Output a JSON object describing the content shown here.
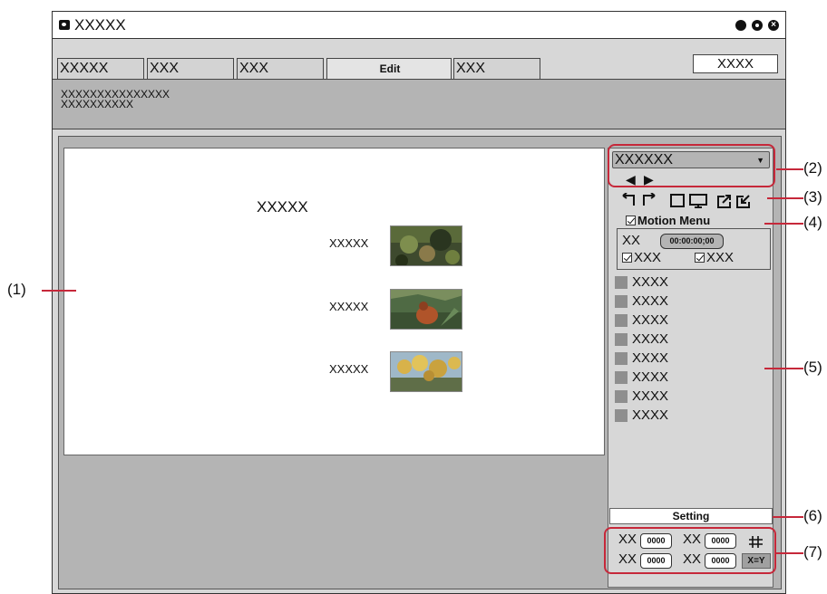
{
  "window": {
    "title": "XXXXX"
  },
  "tabs": [
    {
      "label": "XXXXX"
    },
    {
      "label": "XXX"
    },
    {
      "label": "XXX"
    },
    {
      "label": "Edit"
    },
    {
      "label": "XXX"
    }
  ],
  "top_right_button": "XXXX",
  "info": {
    "line1": "XXXXXXXXXXXXXXX",
    "line2": "XXXXXXXXXX"
  },
  "canvas": {
    "menu_title": "XXXXX",
    "items": [
      {
        "label": "XXXXX"
      },
      {
        "label": "XXXXX"
      },
      {
        "label": "XXXXX"
      }
    ]
  },
  "right_panel": {
    "preset_value": "XXXXXX",
    "motion_menu_label": "Motion Menu",
    "duration_label": "XX",
    "duration_value": "00:00:00;00",
    "check1_label": "XXX",
    "check2_label": "XXX",
    "list_items": [
      "XXXX",
      "XXXX",
      "XXXX",
      "XXXX",
      "XXXX",
      "XXXX",
      "XXXX",
      "XXXX"
    ],
    "setting_label": "Setting",
    "grid": {
      "label_a": "XX",
      "value_a": "0000",
      "label_b": "XX",
      "value_b": "0000",
      "label_c": "XX",
      "value_c": "0000",
      "label_d": "XX",
      "value_d": "0000",
      "xy_label": "X=Y"
    }
  },
  "callouts": [
    "(1)",
    "(2)",
    "(3)",
    "(4)",
    "(5)",
    "(6)",
    "(7)"
  ],
  "colors": {
    "callout": "#c6283a",
    "panel_gray": "#b4b4b4",
    "light_gray": "#d7d7d7",
    "swatch_gray": "#8e8e8e"
  },
  "icons": [
    "undo-icon",
    "redo-icon",
    "square-icon",
    "monitor-icon",
    "export-icon",
    "import-icon",
    "grid-icon",
    "arrow-left-icon",
    "arrow-right-icon",
    "dropdown-arrow-icon"
  ]
}
